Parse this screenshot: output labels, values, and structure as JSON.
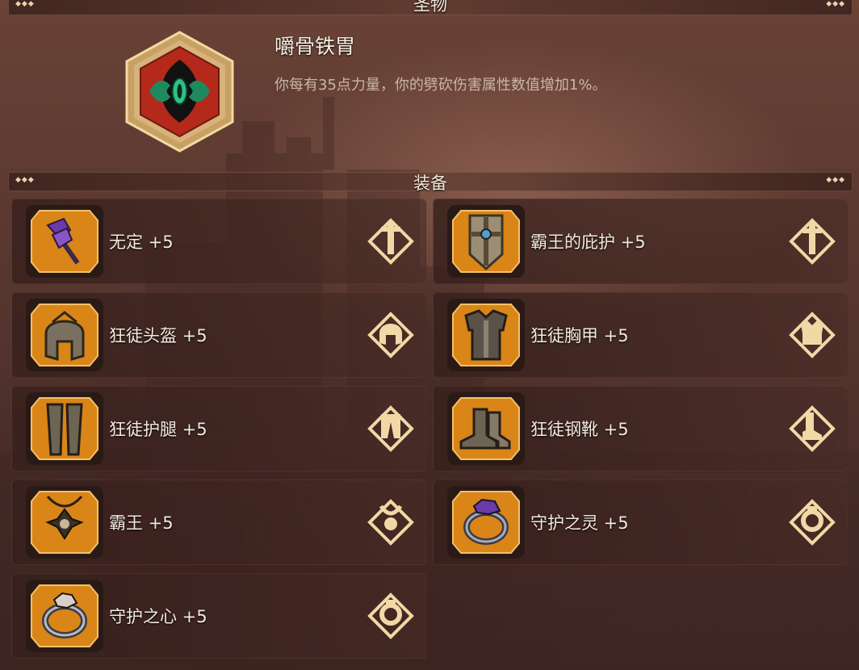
{
  "relic_section": {
    "title": "圣物"
  },
  "relic": {
    "name": "嚼骨铁胃",
    "description": "你每有35点力量，你的劈砍伤害属性数值增加1%。",
    "icon": "relic-ornate-hexagon-icon"
  },
  "equipment_section": {
    "title": "装备"
  },
  "equipment": [
    {
      "label": "无定 +5",
      "item_icon": "axe-icon",
      "slot_icon": "weapon-slot-icon"
    },
    {
      "label": "霸王的庇护 +5",
      "item_icon": "shield-icon",
      "slot_icon": "offhand-slot-icon"
    },
    {
      "label": "狂徒头盔 +5",
      "item_icon": "helmet-icon",
      "slot_icon": "helmet-slot-icon"
    },
    {
      "label": "狂徒胸甲 +5",
      "item_icon": "chest-armor-icon",
      "slot_icon": "chest-slot-icon"
    },
    {
      "label": "狂徒护腿 +5",
      "item_icon": "leg-armor-icon",
      "slot_icon": "legs-slot-icon"
    },
    {
      "label": "狂徒钢靴 +5",
      "item_icon": "boots-icon",
      "slot_icon": "boots-slot-icon"
    },
    {
      "label": "霸王 +5",
      "item_icon": "amulet-icon",
      "slot_icon": "amulet-slot-icon"
    },
    {
      "label": "守护之灵 +5",
      "item_icon": "ring-icon",
      "slot_icon": "ring-slot-icon"
    },
    {
      "label": "守护之心 +5",
      "item_icon": "ring-icon",
      "slot_icon": "ring-slot-icon"
    }
  ],
  "colors": {
    "item_tile": "#d98518",
    "item_tile_border": "#f3c06a",
    "slot_icon": "#f1d8a6",
    "relic_red": "#b4291a",
    "relic_gold": "#e7c27c"
  }
}
